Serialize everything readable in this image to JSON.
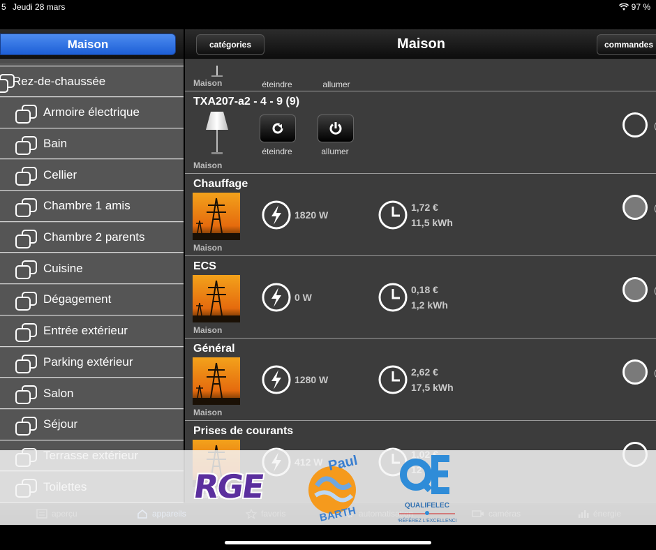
{
  "status_bar": {
    "time": "5",
    "date": "Jeudi 28 mars",
    "battery": "97 %"
  },
  "sidebar": {
    "title": "Maison",
    "top_item": "Rez-de-chaussée",
    "items": [
      {
        "label": "Armoire électrique"
      },
      {
        "label": "Bain"
      },
      {
        "label": "Cellier"
      },
      {
        "label": "Chambre 1 amis"
      },
      {
        "label": "Chambre 2 parents"
      },
      {
        "label": "Cuisine"
      },
      {
        "label": "Dégagement"
      },
      {
        "label": "Entrée extérieur"
      },
      {
        "label": "Parking extérieur"
      },
      {
        "label": "Salon"
      },
      {
        "label": "Séjour"
      },
      {
        "label": "Terrasse extérieur"
      },
      {
        "label": "Toilettes"
      }
    ]
  },
  "header": {
    "left_button": "catégories",
    "title": "Maison",
    "right_button": "commandes"
  },
  "partial_device": {
    "off_label": "éteindre",
    "on_label": "allumer",
    "room": "Maison"
  },
  "light_device": {
    "name": "TXA207-a2 - 4 - 9 (9)",
    "off_label": "éteindre",
    "on_label": "allumer",
    "room": "Maison"
  },
  "energy_devices": [
    {
      "name": "Chauffage",
      "power": "1820 W",
      "cost": "1,72 €",
      "energy": "11,5 kWh",
      "room": "Maison"
    },
    {
      "name": "ECS",
      "power": "0 W",
      "cost": "0,18 €",
      "energy": "1,2 kWh",
      "room": "Maison"
    },
    {
      "name": "Général",
      "power": "1280 W",
      "cost": "2,62 €",
      "energy": "17,5 kWh",
      "room": "Maison"
    },
    {
      "name": "Prises de courants",
      "power": "412 W",
      "cost": "1,02 €",
      "energy": "12",
      "room": "Maison"
    }
  ],
  "tabs": [
    {
      "label": "aperçu",
      "icon": "overview-icon"
    },
    {
      "label": "appareils",
      "icon": "devices-icon"
    },
    {
      "label": "favoris",
      "icon": "star-icon"
    },
    {
      "label": "automatisation",
      "icon": "gear-icon"
    },
    {
      "label": "caméras",
      "icon": "camera-icon"
    },
    {
      "label": "énergie",
      "icon": "chart-icon"
    }
  ],
  "watermark": {
    "rge": "RGE",
    "paul_barth": "Paul BARTH",
    "qualifelec": "QUALIFELEC",
    "qualifelec_tagline": "PRÉFÉREZ L'EXCELLENCE"
  },
  "colors": {
    "sidebar_active": "#2f6fe0",
    "panel_bg": "#3c3c3c",
    "sidebar_bg": "#555555"
  }
}
